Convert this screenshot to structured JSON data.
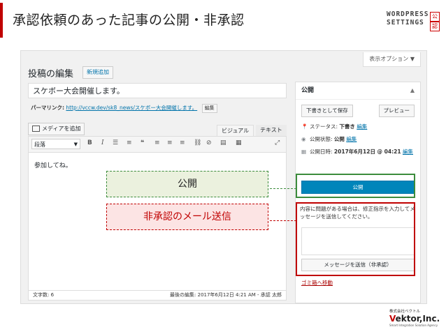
{
  "slide": {
    "title": "承認依頼のあった記事の公開・非承認",
    "logo_lines": [
      "WORDPRESS",
      "SETTINGS"
    ],
    "logo_badges": [
      "公",
      "認"
    ]
  },
  "colors": {
    "accent_red": "#c00000",
    "accent_green": "#3c8c3c",
    "wp_primary": "#0085ba"
  },
  "wp": {
    "screen_options": "表示オプション ▼",
    "page_title": "投稿の編集",
    "add_new": "新規追加",
    "post_title": "スケボー大会開催します。",
    "permalink_label": "パーマリンク:",
    "permalink_url": "http://vccw.dev/sk8_news/スケボー大会開催します。",
    "permalink_edit": "編集",
    "add_media": "メディアを追加",
    "tab_visual": "ビジュアル",
    "tab_text": "テキスト",
    "format_select": "段落",
    "content": "参加してね。",
    "word_count": "文字数: 6",
    "last_edited": "最後の編集: 2017年6月12日 4:21 AM - 承認 太郎"
  },
  "publish_box": {
    "title": "公開",
    "toggle_icon": "caret-up",
    "save_draft": "下書きとして保存",
    "preview": "プレビュー",
    "status_label": "ステータス:",
    "status_value": "下書き",
    "status_edit": "編集",
    "visibility_label": "公開状態:",
    "visibility_value": "公開",
    "visibility_edit": "編集",
    "schedule_label": "公開日時:",
    "schedule_value": "2017年6月12日 @ 04:21",
    "schedule_edit": "編集",
    "publish_button": "公開",
    "reject_instructions": "内容に問題がある場合は、修正指示を入力してメッセージを送信してください。",
    "reject_button": "メッセージを送信（非承認）",
    "trash_link": "ゴミ箱へ移動"
  },
  "annotations": {
    "publish_label": "公開",
    "reject_label": "非承認のメール送信"
  },
  "footer_logo": {
    "top": "株式会社ベクトル",
    "name_v": "V",
    "name_rest": "ektor,Inc.",
    "tagline": "Smart Integration Solution Agency"
  }
}
